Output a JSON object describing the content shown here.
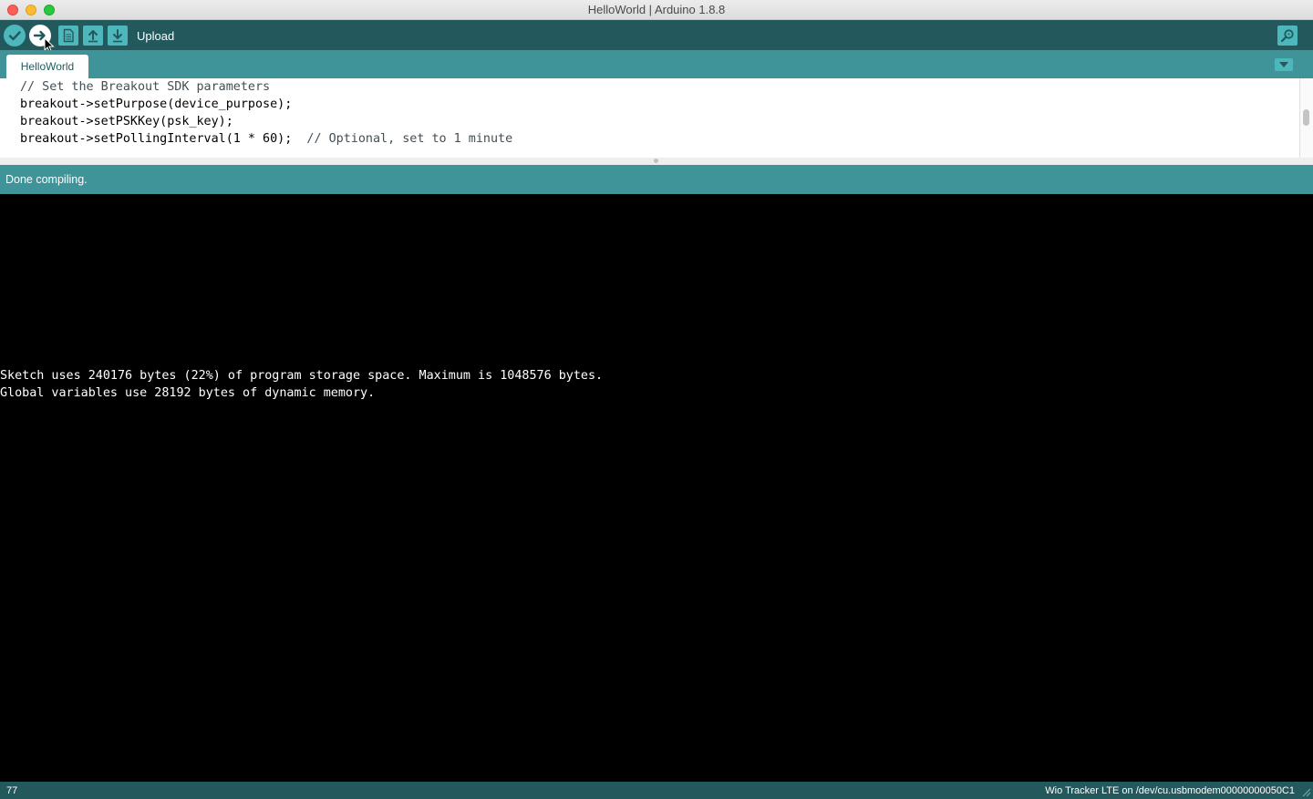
{
  "window": {
    "title": "HelloWorld | Arduino 1.8.8"
  },
  "toolbar": {
    "hover_label": "Upload",
    "buttons": [
      {
        "name": "verify",
        "icon": "checkmark-icon"
      },
      {
        "name": "upload",
        "icon": "arrow-right-icon"
      },
      {
        "name": "new",
        "icon": "document-icon"
      },
      {
        "name": "open",
        "icon": "arrow-up-icon"
      },
      {
        "name": "save",
        "icon": "arrow-down-icon"
      }
    ],
    "serial_monitor_icon": "magnifier-icon"
  },
  "tabs": [
    {
      "label": "HelloWorld",
      "active": true
    }
  ],
  "editor": {
    "lines": [
      {
        "code": "// Set the Breakout SDK parameters",
        "comment": ""
      },
      {
        "code": "breakout->setPurpose(device_purpose);",
        "comment": ""
      },
      {
        "code": "breakout->setPSKKey(psk_key);",
        "comment": ""
      },
      {
        "code": "breakout->setPollingInterval(1 * 60);  ",
        "comment": "// Optional, set to 1 minute"
      }
    ]
  },
  "status": {
    "message": "Done compiling."
  },
  "console": {
    "lines": [
      "Sketch uses 240176 bytes (22%) of program storage space. Maximum is 1048576 bytes.",
      "Global variables use 28192 bytes of dynamic memory."
    ]
  },
  "footer": {
    "line_number": "77",
    "board": "Wio Tracker LTE on /dev/cu.usbmodem00000000050C1"
  },
  "colors": {
    "toolbar": "#23585c",
    "tabbar": "#3f9499",
    "button": "#4db7bb",
    "console_bg": "#000000"
  }
}
